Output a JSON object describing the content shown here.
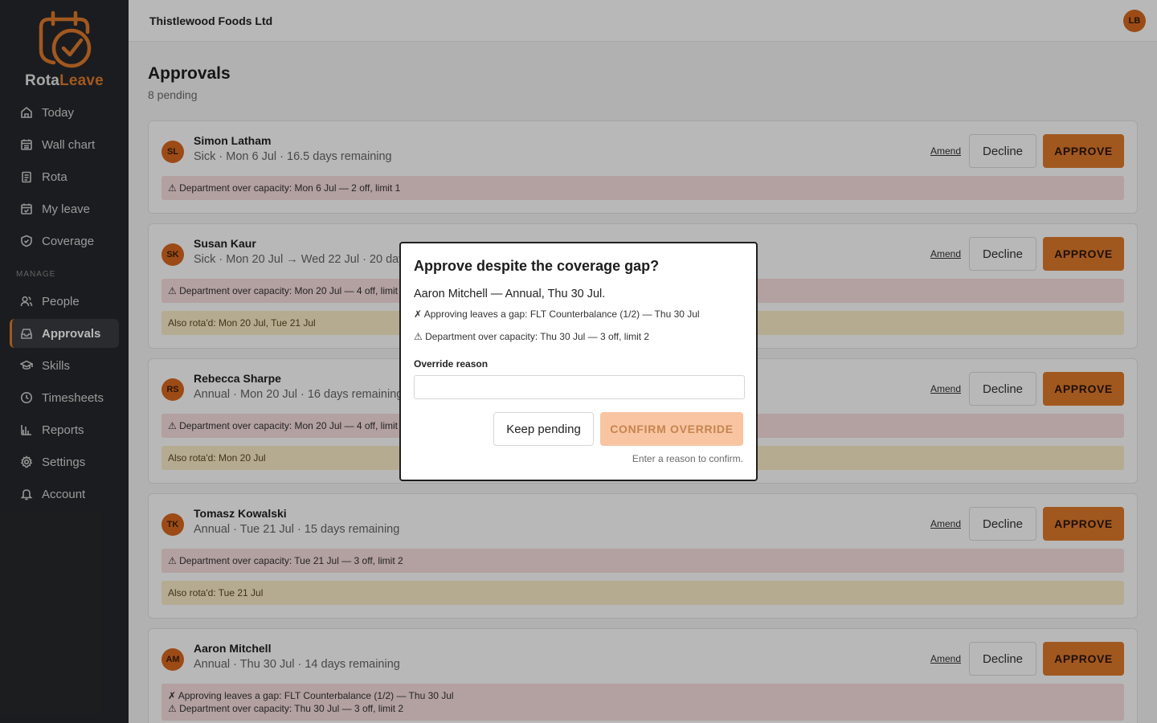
{
  "brand": {
    "name_a": "Rota",
    "name_b": "Leave",
    "accent": "#e07b2c"
  },
  "sidebar": {
    "items": [
      {
        "label": "Today",
        "icon": "home-icon"
      },
      {
        "label": "Wall chart",
        "icon": "calendar-grid-icon"
      },
      {
        "label": "Rota",
        "icon": "clipboard-icon"
      },
      {
        "label": "My leave",
        "icon": "calendar-check-icon"
      },
      {
        "label": "Coverage",
        "icon": "shield-icon"
      }
    ],
    "section": "MANAGE",
    "manage_items": [
      {
        "label": "People",
        "icon": "people-icon"
      },
      {
        "label": "Approvals",
        "icon": "inbox-icon",
        "active": true
      },
      {
        "label": "Skills",
        "icon": "graduation-cap-icon"
      },
      {
        "label": "Timesheets",
        "icon": "clock-icon"
      },
      {
        "label": "Reports",
        "icon": "bar-chart-icon"
      },
      {
        "label": "Settings",
        "icon": "gear-icon"
      },
      {
        "label": "Account",
        "icon": "bell-icon"
      }
    ]
  },
  "topbar": {
    "org": "Thistlewood Foods Ltd",
    "user_initials": "LB"
  },
  "page": {
    "title": "Approvals",
    "subtitle": "8 pending"
  },
  "card_actions": {
    "amend": "Amend",
    "decline": "Decline",
    "approve": "APPROVE"
  },
  "requests": [
    {
      "initials": "SL",
      "name": "Simon Latham",
      "detail": "Sick · Mon 6 Jul · 16.5 days remaining",
      "alerts": [
        {
          "type": "red",
          "text": "⚠ Department over capacity: Mon 6 Jul — 2 off, limit 1"
        }
      ]
    },
    {
      "initials": "SK",
      "name": "Susan Kaur",
      "detail": "Sick · Mon 20 Jul → Wed 22 Jul · 20 days remaining",
      "alerts": [
        {
          "type": "red",
          "text": "⚠ Department over capacity: Mon 20 Jul — 4 off, limit 2"
        },
        {
          "type": "yellow",
          "text": "Also rota'd: Mon 20 Jul, Tue 21 Jul"
        }
      ]
    },
    {
      "initials": "RS",
      "name": "Rebecca Sharpe",
      "detail": "Annual · Mon 20 Jul · 16 days remaining",
      "alerts": [
        {
          "type": "red",
          "text": "⚠ Department over capacity: Mon 20 Jul — 4 off, limit 2"
        },
        {
          "type": "yellow",
          "text": "Also rota'd: Mon 20 Jul"
        }
      ]
    },
    {
      "initials": "TK",
      "name": "Tomasz Kowalski",
      "detail": "Annual · Tue 21 Jul · 15 days remaining",
      "alerts": [
        {
          "type": "red",
          "text": "⚠ Department over capacity: Tue 21 Jul — 3 off, limit 2"
        },
        {
          "type": "yellow",
          "text": "Also rota'd: Tue 21 Jul"
        }
      ]
    },
    {
      "initials": "AM",
      "name": "Aaron Mitchell",
      "detail": "Annual · Thu 30 Jul · 14 days remaining",
      "alerts": [
        {
          "type": "red",
          "lines": [
            "✗ Approving leaves a gap: FLT Counterbalance (1/2) — Thu 30 Jul",
            "⚠ Department over capacity: Thu 30 Jul — 3 off, limit 2"
          ]
        }
      ]
    }
  ],
  "modal": {
    "title": "Approve despite the coverage gap?",
    "subtitle": "Aaron Mitchell — Annual, Thu 30 Jul.",
    "line1": "✗ Approving leaves a gap: FLT Counterbalance (1/2) — Thu 30 Jul",
    "line2": "⚠ Department over capacity: Thu 30 Jul — 3 off, limit 2",
    "field_label": "Override reason",
    "field_value": "",
    "keep": "Keep pending",
    "confirm": "CONFIRM OVERRIDE",
    "hint": "Enter a reason to confirm."
  }
}
